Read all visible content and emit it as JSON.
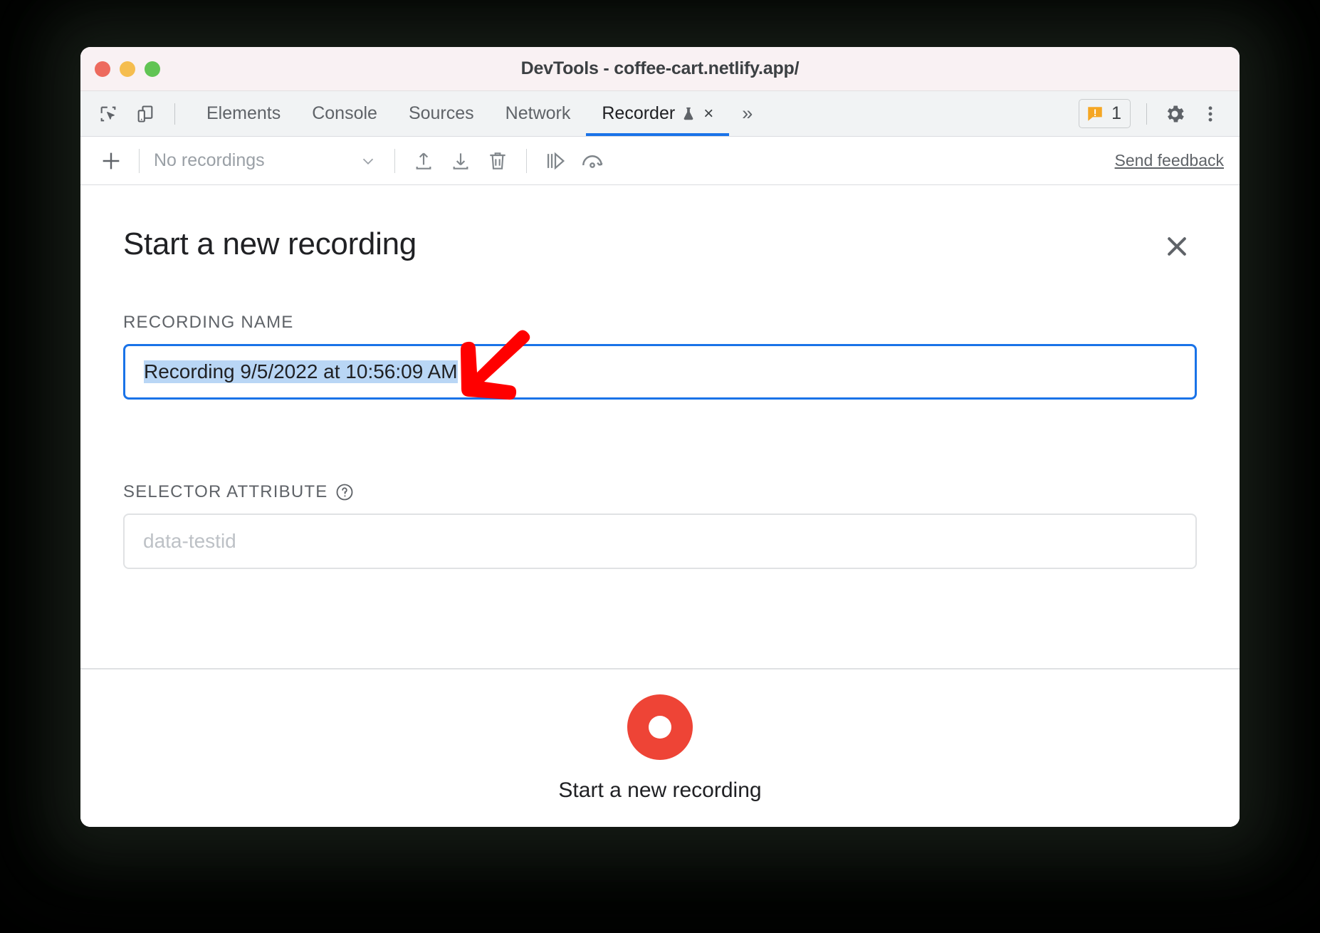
{
  "window": {
    "title": "DevTools - coffee-cart.netlify.app/",
    "traffic_lights": [
      "close",
      "minimize",
      "maximize"
    ]
  },
  "devtools_tabs": {
    "left_icons": [
      {
        "name": "inspect-element-icon",
        "label": "Inspect element"
      },
      {
        "name": "device-toolbar-icon",
        "label": "Toggle device toolbar"
      }
    ],
    "items": [
      {
        "label": "Elements",
        "active": false
      },
      {
        "label": "Console",
        "active": false
      },
      {
        "label": "Sources",
        "active": false
      },
      {
        "label": "Network",
        "active": false
      },
      {
        "label": "Recorder",
        "active": true,
        "experimental": true,
        "closable": true
      }
    ],
    "overflow_label": "»",
    "tab_close_label": "×",
    "right": {
      "warning_count": "1",
      "settings_label": "Settings",
      "more_label": "Customize and control DevTools"
    }
  },
  "recorder_toolbar": {
    "add_label": "+",
    "recordings_select_value": "No recordings",
    "chevron": "⌄",
    "buttons": [
      {
        "name": "import-recording-icon",
        "label": "Import recording"
      },
      {
        "name": "export-recording-icon",
        "label": "Export recording"
      },
      {
        "name": "delete-recording-icon",
        "label": "Delete recording"
      },
      {
        "name": "step-replay-icon",
        "label": "Step / replay"
      },
      {
        "name": "performance-replay-icon",
        "label": "Measure performance while replaying"
      }
    ],
    "send_feedback_label": "Send feedback"
  },
  "panel": {
    "title": "Start a new recording",
    "close_label": "×",
    "recording_name": {
      "label": "Recording name",
      "value": "Recording 9/5/2022 at 10:56:09 AM",
      "selected": true
    },
    "selector_attribute": {
      "label": "Selector attribute",
      "help_label": "?",
      "value": "",
      "placeholder": "data-testid"
    },
    "footer": {
      "record_button_label": "Start a new recording"
    }
  },
  "annotation": {
    "arrow": {
      "color": "#ff0000",
      "direction": "down-left",
      "points_at": "recording-name-input"
    }
  },
  "colors": {
    "accent_blue": "#1a73e8",
    "record_red": "#ee4436",
    "selection_blue": "#b9d6f5",
    "warning_orange": "#f5a623",
    "titlebar_bg": "#f9f1f3",
    "tabstrip_bg": "#f1f3f4",
    "arrow_red": "#ff0000"
  }
}
